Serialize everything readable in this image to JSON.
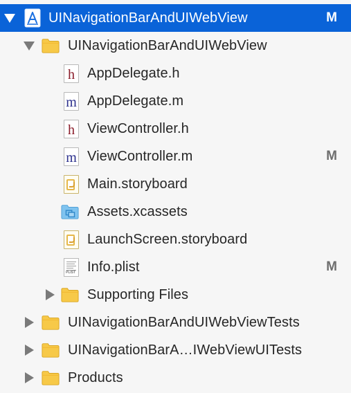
{
  "project": {
    "name": "UINavigationBarAndUIWebView",
    "badge": "M",
    "icon": "xcode-project-icon"
  },
  "group": {
    "name": "UINavigationBarAndUIWebView",
    "icon": "folder-icon"
  },
  "files": [
    {
      "name": "AppDelegate.h",
      "type": "h",
      "badge": ""
    },
    {
      "name": "AppDelegate.m",
      "type": "m",
      "badge": ""
    },
    {
      "name": "ViewController.h",
      "type": "h",
      "badge": ""
    },
    {
      "name": "ViewController.m",
      "type": "m",
      "badge": "M"
    },
    {
      "name": "Main.storyboard",
      "type": "storyboard",
      "badge": ""
    },
    {
      "name": "Assets.xcassets",
      "type": "xcassets",
      "badge": ""
    },
    {
      "name": "LaunchScreen.storyboard",
      "type": "storyboard",
      "badge": ""
    },
    {
      "name": "Info.plist",
      "type": "plist",
      "badge": "M"
    }
  ],
  "icon_letters": {
    "h": "h",
    "m": "m",
    "plist_tag": "PLIST"
  },
  "supporting_files": {
    "name": "Supporting Files"
  },
  "top_groups": [
    {
      "name": "UINavigationBarAndUIWebViewTests"
    },
    {
      "name": "UINavigationBarA…IWebViewUITests"
    },
    {
      "name": "Products"
    }
  ],
  "colors": {
    "selection": "#0a63d8",
    "folder": "#f7c948",
    "folder_blue": "#7fc3ef",
    "header_letter": "#8a1c2a",
    "impl_letter": "#2b2f8c"
  }
}
